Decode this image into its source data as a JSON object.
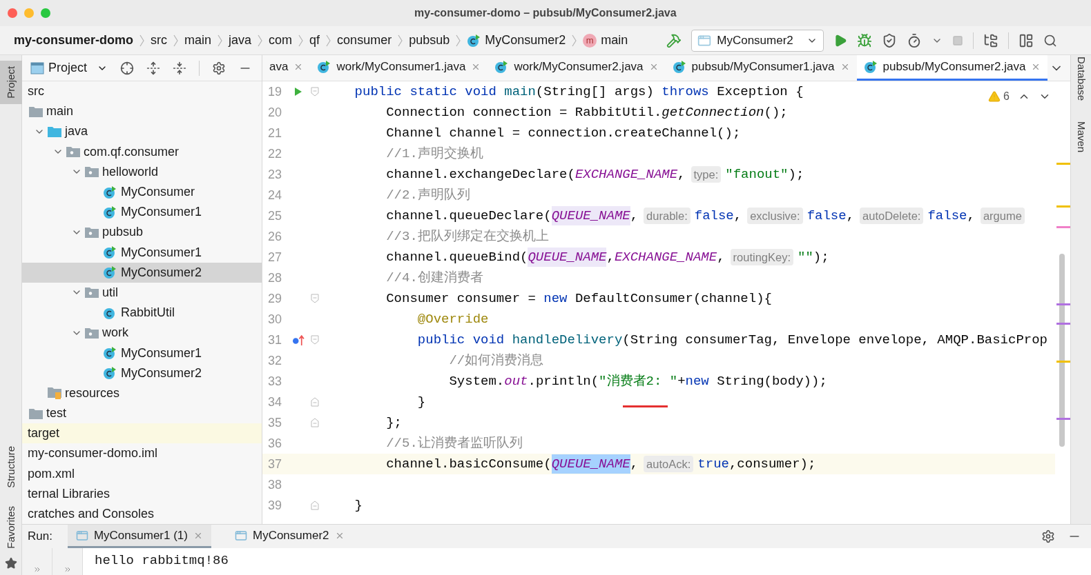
{
  "window": {
    "title": "my-consumer-domo – pubsub/MyConsumer2.java"
  },
  "breadcrumbs": [
    {
      "label": "my-consumer-domo",
      "kind": "project"
    },
    {
      "label": "src",
      "kind": "folder"
    },
    {
      "label": "main",
      "kind": "folder"
    },
    {
      "label": "java",
      "kind": "folder"
    },
    {
      "label": "com",
      "kind": "folder"
    },
    {
      "label": "qf",
      "kind": "folder"
    },
    {
      "label": "consumer",
      "kind": "folder"
    },
    {
      "label": "pubsub",
      "kind": "folder"
    },
    {
      "label": "MyConsumer2",
      "kind": "class"
    },
    {
      "label": "main",
      "kind": "method",
      "badge": "m"
    }
  ],
  "toolbar": {
    "run_config": "MyConsumer2"
  },
  "project_panel": {
    "title": "Project"
  },
  "tree": [
    {
      "label": "src",
      "selected": false,
      "highlighted": false,
      "children": [
        {
          "label": "main",
          "kind": "folder",
          "selected": false,
          "highlighted": false,
          "children": [
            {
              "label": "java",
              "kind": "source_folder",
              "expanded": true,
              "selected": false,
              "highlighted": false,
              "children": [
                {
                  "label": "com.qf.consumer",
                  "kind": "package",
                  "expanded": true,
                  "selected": false,
                  "highlighted": false,
                  "children": [
                    {
                      "label": "helloworld",
                      "kind": "package",
                      "expanded": true,
                      "selected": false,
                      "highlighted": false,
                      "children": [
                        {
                          "label": "MyConsumer",
                          "kind": "runnable_class",
                          "selected": false,
                          "highlighted": false
                        },
                        {
                          "label": "MyConsumer1",
                          "kind": "runnable_class",
                          "selected": false,
                          "highlighted": false
                        }
                      ]
                    },
                    {
                      "label": "pubsub",
                      "kind": "package",
                      "expanded": true,
                      "selected": false,
                      "highlighted": false,
                      "children": [
                        {
                          "label": "MyConsumer1",
                          "kind": "runnable_class",
                          "selected": false,
                          "highlighted": false
                        },
                        {
                          "label": "MyConsumer2",
                          "kind": "runnable_class",
                          "selected": true,
                          "highlighted": false
                        }
                      ]
                    },
                    {
                      "label": "util",
                      "kind": "package",
                      "expanded": true,
                      "selected": false,
                      "highlighted": false,
                      "children": [
                        {
                          "label": "RabbitUtil",
                          "kind": "class",
                          "selected": false,
                          "highlighted": false
                        }
                      ]
                    },
                    {
                      "label": "work",
                      "kind": "package",
                      "expanded": true,
                      "selected": false,
                      "highlighted": false,
                      "children": [
                        {
                          "label": "MyConsumer1",
                          "kind": "runnable_class",
                          "selected": false,
                          "highlighted": false
                        },
                        {
                          "label": "MyConsumer2",
                          "kind": "runnable_class",
                          "selected": false,
                          "highlighted": false
                        }
                      ]
                    }
                  ]
                }
              ]
            },
            {
              "label": "resources",
              "kind": "resources_folder",
              "selected": false,
              "highlighted": false
            }
          ]
        },
        {
          "label": "test",
          "kind": "folder",
          "selected": false,
          "highlighted": false
        }
      ]
    },
    {
      "label": "target",
      "selected": false,
      "highlighted": true
    },
    {
      "label": "my-consumer-domo.iml",
      "selected": false,
      "highlighted": false
    },
    {
      "label": "pom.xml",
      "selected": false,
      "highlighted": false
    },
    {
      "label": "ternal Libraries",
      "selected": false,
      "highlighted": false
    },
    {
      "label": "cratches and Consoles",
      "selected": false,
      "highlighted": false
    }
  ],
  "editor_tabs": [
    {
      "label": "ava",
      "selected": false
    },
    {
      "label": "work/MyConsumer1.java",
      "kind": "runnable_class",
      "selected": false
    },
    {
      "label": "work/MyConsumer2.java",
      "kind": "runnable_class",
      "selected": false
    },
    {
      "label": "pubsub/MyConsumer1.java",
      "kind": "runnable_class",
      "selected": false
    },
    {
      "label": "pubsub/MyConsumer2.java",
      "kind": "runnable_class",
      "selected": true
    }
  ],
  "inspections": {
    "warnings": "6"
  },
  "code_lines": [
    {
      "num": "19",
      "current": false,
      "markers": [
        {
          "kind": "run"
        },
        {
          "kind": "fold_open"
        }
      ],
      "tokens": [
        {
          "kind": "keyword",
          "text": "    public static void "
        },
        {
          "kind": "decl",
          "text": "main"
        },
        {
          "kind": "plain",
          "text": "(String[] args) "
        },
        {
          "kind": "keyword",
          "text": "throws"
        },
        {
          "kind": "plain",
          "text": " Exception {"
        }
      ]
    },
    {
      "num": "20",
      "current": false,
      "tokens": [
        {
          "kind": "plain",
          "text": "        Connection connection = RabbitUtil."
        },
        {
          "kind": "italic",
          "text": "getConnection"
        },
        {
          "kind": "plain",
          "text": "();"
        }
      ]
    },
    {
      "num": "21",
      "current": false,
      "tokens": [
        {
          "kind": "plain",
          "text": "        Channel channel = connection.createChannel();"
        }
      ]
    },
    {
      "num": "22",
      "current": false,
      "tokens": [
        {
          "kind": "comment",
          "text": "        //1.声明交换机"
        }
      ]
    },
    {
      "num": "23",
      "current": false,
      "tokens": [
        {
          "kind": "plain",
          "text": "        channel.exchangeDeclare("
        },
        {
          "kind": "static",
          "text": "EXCHANGE_NAME"
        },
        {
          "kind": "plain",
          "text": ","
        },
        {
          "kind": "hint",
          "text": "type:"
        },
        {
          "kind": "string",
          "text": "\"fanout\""
        },
        {
          "kind": "plain",
          "text": ");"
        }
      ]
    },
    {
      "num": "24",
      "current": false,
      "tokens": [
        {
          "kind": "comment",
          "text": "        //2.声明队列"
        }
      ]
    },
    {
      "num": "25",
      "current": false,
      "tokens": [
        {
          "kind": "plain",
          "text": "        channel.queueDeclare("
        },
        {
          "kind": "static_hl",
          "text": "QUEUE_NAME"
        },
        {
          "kind": "plain",
          "text": ","
        },
        {
          "kind": "hint",
          "text": "durable:"
        },
        {
          "kind": "keyword",
          "text": "false"
        },
        {
          "kind": "plain",
          "text": ","
        },
        {
          "kind": "hint",
          "text": "exclusive:"
        },
        {
          "kind": "keyword",
          "text": "false"
        },
        {
          "kind": "plain",
          "text": ","
        },
        {
          "kind": "hint",
          "text": "autoDelete:"
        },
        {
          "kind": "keyword",
          "text": "false"
        },
        {
          "kind": "plain",
          "text": ","
        },
        {
          "kind": "hint",
          "text": "argume"
        }
      ]
    },
    {
      "num": "26",
      "current": false,
      "tokens": [
        {
          "kind": "comment",
          "text": "        //3.把队列绑定在交换机上"
        }
      ]
    },
    {
      "num": "27",
      "current": false,
      "tokens": [
        {
          "kind": "plain",
          "text": "        channel.queueBind("
        },
        {
          "kind": "static_hl",
          "text": "QUEUE_NAME"
        },
        {
          "kind": "plain",
          "text": ","
        },
        {
          "kind": "static",
          "text": "EXCHANGE_NAME"
        },
        {
          "kind": "plain",
          "text": ","
        },
        {
          "kind": "hint",
          "text": "routingKey:"
        },
        {
          "kind": "string",
          "text": "\"\""
        },
        {
          "kind": "plain",
          "text": ");"
        }
      ]
    },
    {
      "num": "28",
      "current": false,
      "tokens": [
        {
          "kind": "comment",
          "text": "        //4.创建消费者"
        }
      ]
    },
    {
      "num": "29",
      "current": false,
      "markers": [
        {
          "kind": "fold_open"
        }
      ],
      "tokens": [
        {
          "kind": "plain",
          "text": "        Consumer consumer = "
        },
        {
          "kind": "keyword",
          "text": "new"
        },
        {
          "kind": "plain",
          "text": " DefaultConsumer(channel){"
        }
      ]
    },
    {
      "num": "30",
      "current": false,
      "tokens": [
        {
          "kind": "annotation",
          "text": "            @Override"
        }
      ]
    },
    {
      "num": "31",
      "current": false,
      "markers": [
        {
          "kind": "override"
        },
        {
          "kind": "fold_open"
        }
      ],
      "tokens": [
        {
          "kind": "keyword",
          "text": "            public void "
        },
        {
          "kind": "decl",
          "text": "handleDelivery"
        },
        {
          "kind": "plain",
          "text": "(String consumerTag, Envelope envelope, AMQP.BasicProp"
        }
      ]
    },
    {
      "num": "32",
      "current": false,
      "tokens": [
        {
          "kind": "comment",
          "text": "                //如何消费消息"
        }
      ]
    },
    {
      "num": "33",
      "current": false,
      "tokens": [
        {
          "kind": "plain",
          "text": "                System."
        },
        {
          "kind": "static",
          "text": "out"
        },
        {
          "kind": "plain",
          "text": ".println("
        },
        {
          "kind": "string",
          "text": "\"消费者2: \""
        },
        {
          "kind": "plain",
          "text": "+"
        },
        {
          "kind": "keyword",
          "text": "new"
        },
        {
          "kind": "plain",
          "text": " String(body));"
        }
      ]
    },
    {
      "num": "34",
      "current": false,
      "markers": [
        {
          "kind": "fold_close"
        }
      ],
      "tokens": [
        {
          "kind": "plain",
          "text": "            }"
        }
      ]
    },
    {
      "num": "35",
      "current": false,
      "markers": [
        {
          "kind": "fold_close"
        }
      ],
      "tokens": [
        {
          "kind": "plain",
          "text": "        };"
        }
      ]
    },
    {
      "num": "36",
      "current": false,
      "tokens": [
        {
          "kind": "comment",
          "text": "        //5.让消费者监听队列"
        }
      ]
    },
    {
      "num": "37",
      "current": true,
      "tokens": [
        {
          "kind": "plain",
          "text": "        channel.basicConsume("
        },
        {
          "kind": "static_sel",
          "text": "QUEUE_NAME"
        },
        {
          "kind": "plain",
          "text": ","
        },
        {
          "kind": "hint",
          "text": "autoAck:"
        },
        {
          "kind": "keyword",
          "text": "true"
        },
        {
          "kind": "plain",
          "text": ",consumer);"
        }
      ]
    },
    {
      "num": "38",
      "current": false
    },
    {
      "num": "39",
      "current": false,
      "markers": [
        {
          "kind": "fold_close"
        }
      ],
      "tokens": [
        {
          "kind": "plain",
          "text": "    }"
        }
      ]
    }
  ],
  "side_tools": {
    "left": [
      {
        "label": "Project",
        "selected": true
      },
      {
        "label": "Structure",
        "selected": false
      },
      {
        "label": "Favorites",
        "selected": false
      }
    ],
    "right": [
      {
        "label": "Database"
      },
      {
        "label": "Maven"
      }
    ]
  },
  "run_panel": {
    "label": "Run:",
    "tabs": [
      {
        "label": "MyConsumer1 (1)",
        "selected": true
      },
      {
        "label": "MyConsumer2",
        "selected": false
      }
    ],
    "output": "hello rabbitmq!86"
  }
}
